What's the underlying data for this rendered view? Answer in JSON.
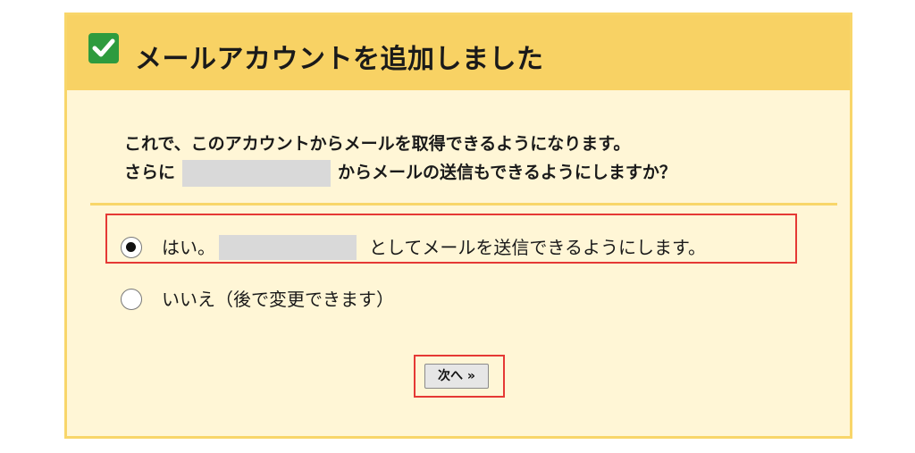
{
  "header": {
    "icon": "checkmark-icon",
    "title": "メールアカウントを追加しました",
    "background_color": "#f8d264",
    "icon_color": "#2e9b3e"
  },
  "message": {
    "line1": "これで、このアカウントからメールを取得できるようになります。",
    "line2_prefix": "さらに",
    "line2_suffix": "からメールの送信もできるようにしますか？"
  },
  "options": [
    {
      "prefix": "はい。",
      "suffix": "としてメールを送信できるようにします。",
      "selected": true
    },
    {
      "label": "いいえ（後で変更できます）",
      "selected": false
    }
  ],
  "next_button": {
    "label": "次へ »"
  },
  "highlight_color": "#e53935",
  "panel_background": "#fff6d6"
}
